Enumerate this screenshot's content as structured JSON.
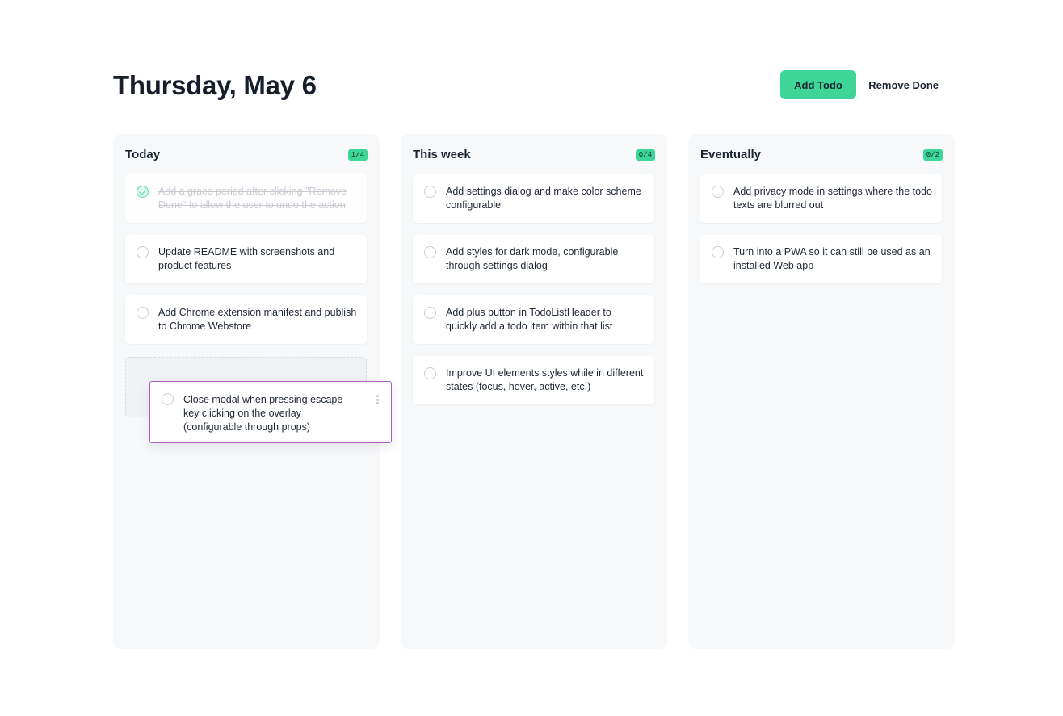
{
  "header": {
    "title": "Thursday, May 6",
    "add_button": "Add Todo",
    "remove_button": "Remove Done"
  },
  "colors": {
    "accent": "#3dd598",
    "drag_border": "#b15cc2",
    "column_bg": "#f7f8fa"
  },
  "columns": [
    {
      "title": "Today",
      "count": "1/4",
      "items": [
        {
          "text": "Add a grace period after clicking \"Remove Done\" to allow the user to undo the action",
          "done": true
        },
        {
          "text": "Update README with screenshots and product features",
          "done": false
        },
        {
          "text": "Add Chrome extension manifest and publish to Chrome Webstore",
          "done": false
        }
      ]
    },
    {
      "title": "This week",
      "count": "0/4",
      "items": [
        {
          "text": "Add settings dialog and make color scheme configurable",
          "done": false
        },
        {
          "text": "Add styles for dark mode, configurable through settings dialog",
          "done": false
        },
        {
          "text": "Add plus button in TodoListHeader to quickly add a todo item within that list",
          "done": false
        },
        {
          "text": "Improve UI elements styles while in different states (focus, hover, active, etc.)",
          "done": false
        }
      ]
    },
    {
      "title": "Eventually",
      "count": "0/2",
      "items": [
        {
          "text": "Add privacy mode in settings where the todo texts are blurred out",
          "done": false
        },
        {
          "text": "Turn into a PWA so it can still be used as an installed Web app",
          "done": false
        }
      ]
    }
  ],
  "dragging": {
    "text": "Close modal when pressing escape key clicking on the overlay (configurable through props)"
  }
}
